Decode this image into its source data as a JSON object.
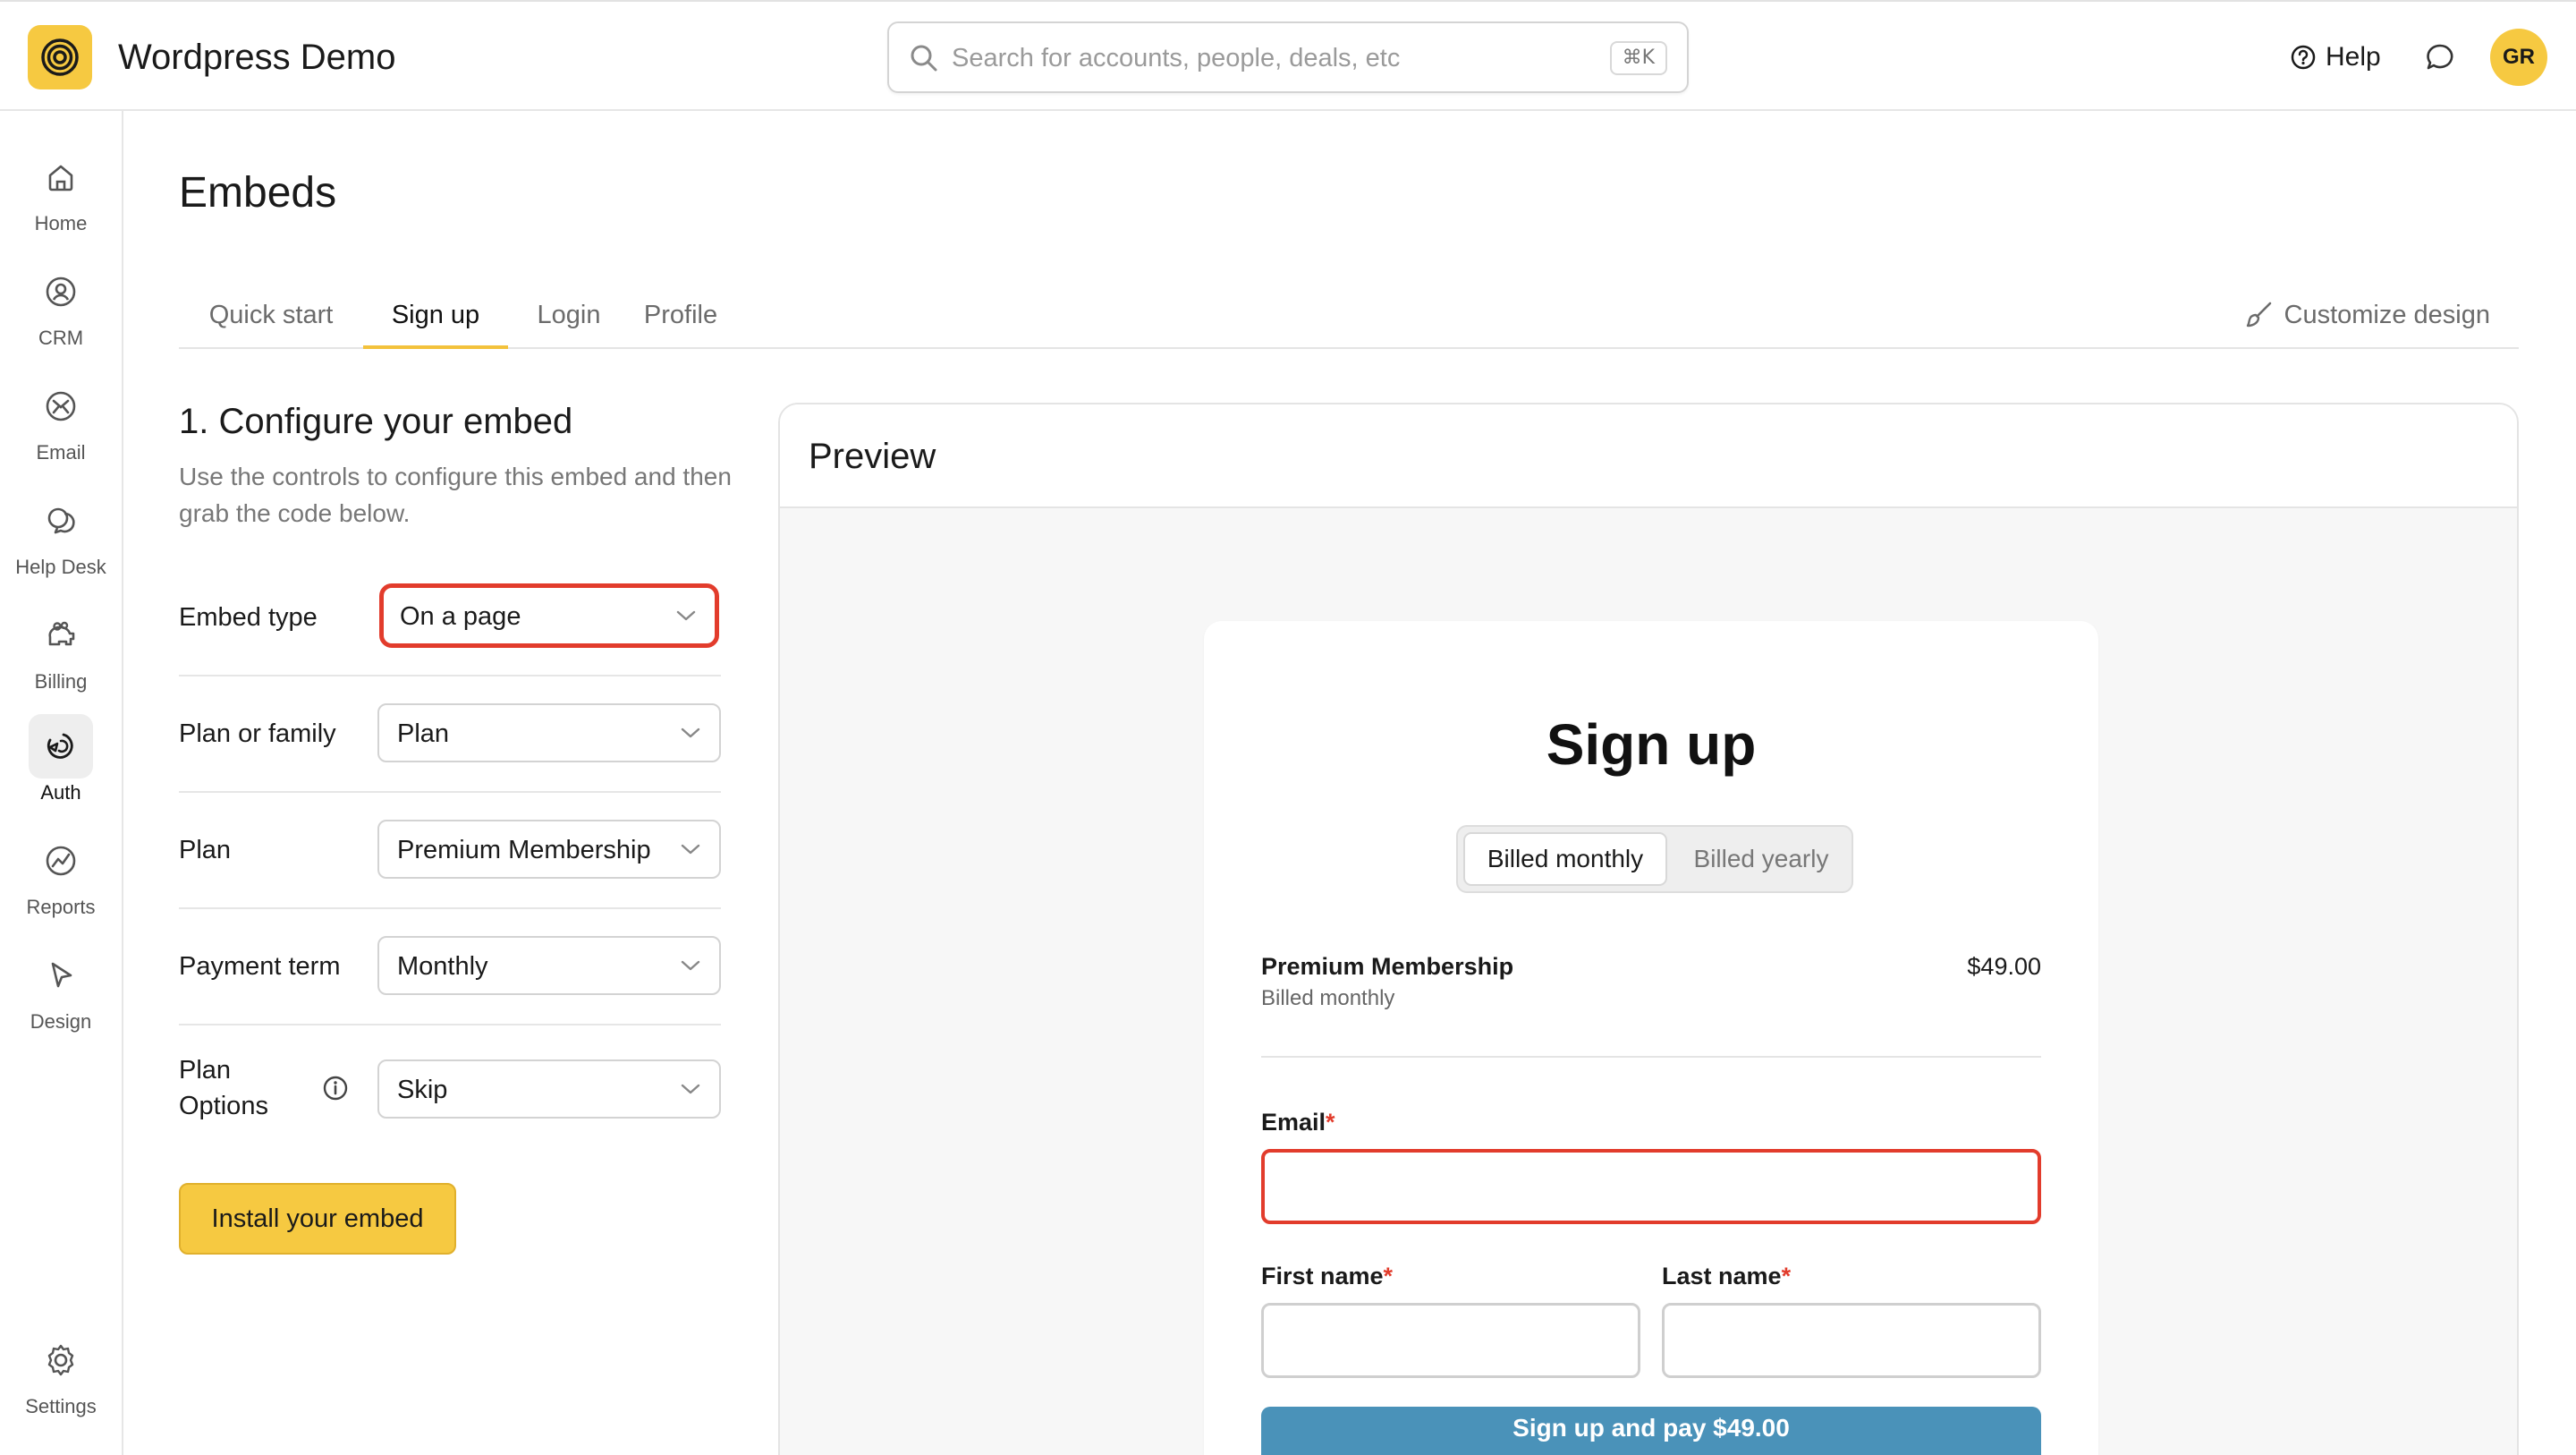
{
  "app": {
    "title": "Wordpress Demo",
    "logo_icon": "target-spiral-icon",
    "brand_color": "#f6c941"
  },
  "search": {
    "placeholder": "Search for accounts, people, deals, etc",
    "shortcut": "⌘K"
  },
  "header": {
    "help_label": "Help",
    "avatar_initials": "GR"
  },
  "sidebar": {
    "items": [
      {
        "label": "Home",
        "icon": "home-icon"
      },
      {
        "label": "CRM",
        "icon": "contact-icon"
      },
      {
        "label": "Email",
        "icon": "mail-icon"
      },
      {
        "label": "Help Desk",
        "icon": "chat-bubbles-icon"
      },
      {
        "label": "Billing",
        "icon": "piggy-bank-icon"
      },
      {
        "label": "Auth",
        "icon": "auth-icon",
        "active": true
      },
      {
        "label": "Reports",
        "icon": "chart-icon"
      },
      {
        "label": "Design",
        "icon": "cursor-icon"
      },
      {
        "label": "Settings",
        "icon": "gear-icon"
      }
    ]
  },
  "page": {
    "title": "Embeds"
  },
  "tabs": [
    {
      "label": "Quick start"
    },
    {
      "label": "Sign up",
      "active": true
    },
    {
      "label": "Login"
    },
    {
      "label": "Profile"
    }
  ],
  "customize_label": "Customize design",
  "config": {
    "title": "1. Configure your embed",
    "description": "Use the controls to configure this embed and then grab the code below.",
    "rows": [
      {
        "label": "Embed type",
        "value": "On a page"
      },
      {
        "label": "Plan or family",
        "value": "Plan"
      },
      {
        "label": "Plan",
        "value": "Premium Membership"
      },
      {
        "label": "Payment term",
        "value": "Monthly"
      },
      {
        "label": "Plan Options",
        "value": "Skip"
      }
    ],
    "install_label": "Install your embed"
  },
  "preview": {
    "title": "Preview",
    "signup_title": "Sign up",
    "billing_options": [
      "Billed monthly",
      "Billed yearly"
    ],
    "plan_name": "Premium Membership",
    "plan_term": "Billed monthly",
    "plan_price": "$49.00",
    "fields": {
      "email": "Email",
      "first_name": "First name",
      "last_name": "Last name",
      "required_mark": "*"
    },
    "submit_label": "Sign up and pay $49.00",
    "button_color": "#4a92b9",
    "error_color": "#e23c2c"
  }
}
